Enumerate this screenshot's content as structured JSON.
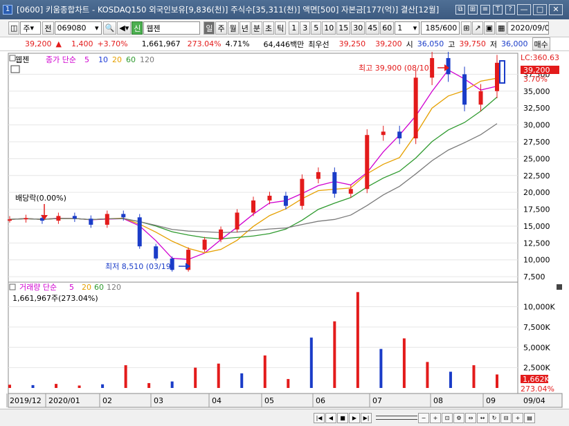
{
  "window": {
    "num": "1",
    "title": "[0600] 키움종합차트 - KOSDAQ150 외국인보유[9,836(천)] 주식수[35,311(천)] 액면[500] 자본금[177(억)] 결산[12월]"
  },
  "toolbar": {
    "code_type": "주",
    "code_prefix": "전",
    "code": "069080",
    "signal": "신",
    "name": "웹젠",
    "periods": [
      "일",
      "주",
      "월",
      "년",
      "분",
      "초",
      "틱"
    ],
    "minutes": [
      "1",
      "3",
      "5",
      "10",
      "15",
      "30",
      "45",
      "60"
    ],
    "tick_count": "1",
    "page": "185/600",
    "date": "2020/09/04"
  },
  "quote": {
    "price": "39,200",
    "arrow": "▲",
    "change": "1,400",
    "change_pct": "+3.70%",
    "volume": "1,661,967",
    "vol_ratio": "273.04%",
    "turnover": "4.71%",
    "amount": "64,446백만",
    "best_label": "최우선",
    "best_ask": "39,250",
    "best_bid": "39,200",
    "open_label": "시",
    "open": "36,050",
    "high_label": "고",
    "high": "39,750",
    "low_label": "저",
    "low": "36,000",
    "buy_button": "매수"
  },
  "price_legend": {
    "name": "웹젠",
    "title": "종가 단순",
    "periods": [
      "5",
      "10",
      "20",
      "60",
      "120"
    ]
  },
  "volume_legend": {
    "title": "거래량 단순",
    "periods": [
      "5",
      "20",
      "60",
      "120"
    ],
    "value": "1,661,967주(273.04%)"
  },
  "annotations": {
    "high": "최고 39,900 (08/10)",
    "low": "최저 8,510 (03/19)",
    "dividend": "배당락(0.00%)",
    "lc": "LC:360.63",
    "last_price": "39,200",
    "last_pct": "3.70%",
    "last_vol": "1,662K",
    "last_vol_pct": "273.04%"
  },
  "colors": {
    "up": "#e31b1b",
    "down": "#1a3cc8",
    "ma5": "#d000d0",
    "ma10": "#1f3dd8",
    "ma20": "#e6a000",
    "ma60": "#2e9a2e",
    "ma120": "#7a7a7a"
  },
  "chart_data": [
    {
      "type": "line",
      "title": "",
      "x_ticks": [
        "2019/12",
        "2020/01",
        "02",
        "03",
        "04",
        "05",
        "06",
        "07",
        "08",
        "09",
        "09/04"
      ],
      "y_ticks": [
        "7,500",
        "10,000",
        "12,500",
        "15,000",
        "17,500",
        "20,000",
        "22,500",
        "25,000",
        "27,500",
        "30,000",
        "32,500",
        "35,000",
        "37,500"
      ],
      "series": [
        {
          "name": "종가",
          "values": [
            16000,
            16200,
            15800,
            16500,
            16100,
            15200,
            16800,
            16300,
            12000,
            10200,
            8510,
            11500,
            13000,
            14500,
            17000,
            18800,
            19500,
            18000,
            22000,
            23000,
            19800,
            20500,
            28500,
            29000,
            28000,
            37000,
            39900,
            37500,
            33000,
            35000,
            39200
          ]
        }
      ],
      "ylim": [
        7000,
        40000
      ]
    },
    {
      "type": "bar",
      "title": "",
      "y_ticks": [
        "2,500K",
        "5,000K",
        "7,500K",
        "10,000K"
      ],
      "values_k": [
        400,
        350,
        500,
        300,
        450,
        2800,
        600,
        800,
        2500,
        3000,
        1800,
        4000,
        1100,
        6200,
        8200,
        11800,
        4800,
        6100,
        3200,
        2000,
        2800,
        1662
      ],
      "ylim": [
        0,
        12000
      ]
    }
  ]
}
